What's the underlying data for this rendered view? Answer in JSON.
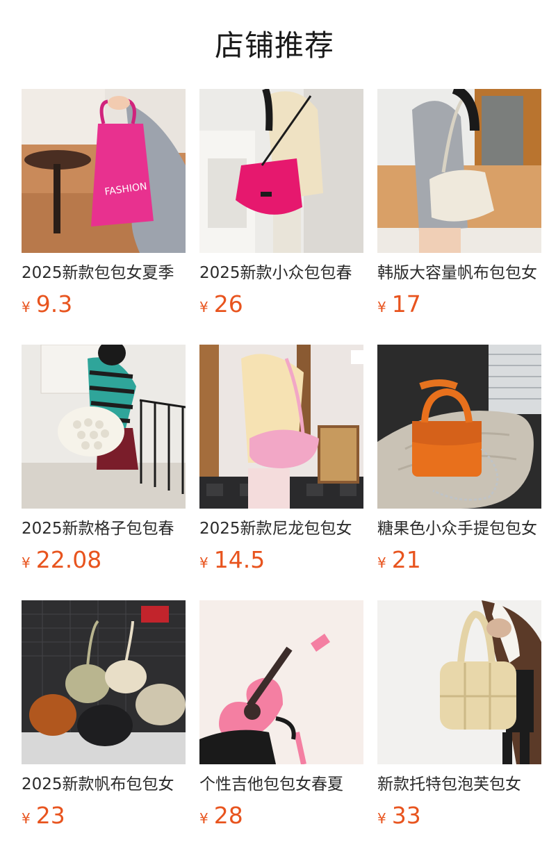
{
  "section": {
    "title": "店铺推荐"
  },
  "colors": {
    "price": "#e8541e",
    "title": "#1a1a1a",
    "name": "#2a2a2a"
  },
  "products": [
    {
      "name": "2025新款包包女夏季",
      "currency": "¥",
      "price": "9.3",
      "image": "pink-fashion-tote-photo"
    },
    {
      "name": "2025新款小众包包春",
      "currency": "¥",
      "price": "26",
      "image": "magenta-crossbody-bag-photo"
    },
    {
      "name": "韩版大容量帆布包包女",
      "currency": "¥",
      "price": "17",
      "image": "cream-canvas-shoulder-bag-photo"
    },
    {
      "name": "2025新款格子包包春",
      "currency": "¥",
      "price": "22.08",
      "image": "white-quilted-shoulder-bag-photo"
    },
    {
      "name": "2025新款尼龙包包女",
      "currency": "¥",
      "price": "14.5",
      "image": "pink-nylon-cloud-bag-photo"
    },
    {
      "name": "糖果色小众手提包包女",
      "currency": "¥",
      "price": "21",
      "image": "orange-handbag-chain-photo"
    },
    {
      "name": "2025新款帆布包包女",
      "currency": "¥",
      "price": "23",
      "image": "canvas-hobo-bags-collection-photo"
    },
    {
      "name": "个性吉他包包女春夏",
      "currency": "¥",
      "price": "28",
      "image": "pink-guitar-bag-photo"
    },
    {
      "name": "新款托特包泡芙包女",
      "currency": "¥",
      "price": "33",
      "image": "beige-puffer-tote-photo"
    }
  ]
}
